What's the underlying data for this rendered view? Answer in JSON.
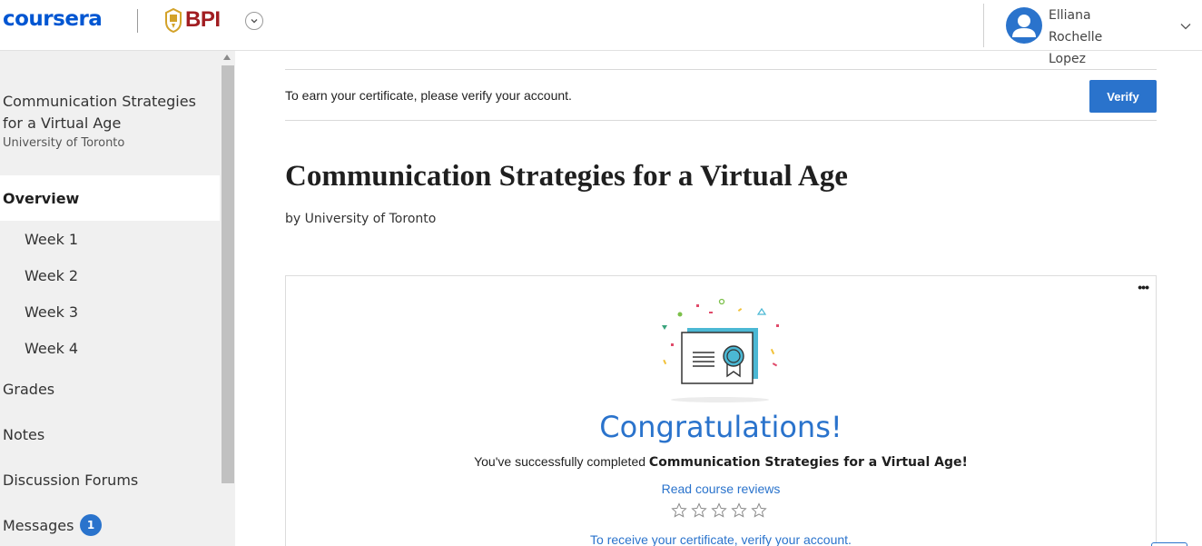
{
  "header": {
    "brand": "coursera",
    "partner": "BPI",
    "user": {
      "first_line": "Elliana Rochelle",
      "second_line": "Lopez"
    }
  },
  "sidebar": {
    "course_title": "Communication Strategies for a Virtual Age",
    "university": "University of Toronto",
    "overview": "Overview",
    "weeks": [
      "Week 1",
      "Week 2",
      "Week 3",
      "Week 4"
    ],
    "grades": "Grades",
    "notes": "Notes",
    "forums": "Discussion Forums",
    "messages": "Messages",
    "messages_badge": "1"
  },
  "main": {
    "verify_text": "To earn your certificate, please verify your account.",
    "verify_button": "Verify",
    "title": "Communication Strategies for a Virtual Age",
    "by": "by University of Toronto",
    "card": {
      "more": "•••",
      "congrats": "Congratulations!",
      "completed_prefix": "You've successfully completed ",
      "completed_course": "Communication Strategies for a Virtual Age",
      "completed_suffix": "!",
      "reviews_link": "Read course reviews",
      "receive_link": "To receive your certificate, verify your account."
    }
  },
  "colors": {
    "accent": "#2a73cc",
    "coursera_blue": "#0056d2",
    "bpi_red": "#a11d21",
    "sidebar_bg": "#f0f0f0"
  },
  "icons": {
    "switcher": "chevron-down-icon",
    "user": "user-avatar-icon",
    "user_menu": "chevron-down-icon",
    "certificate": "certificate-illustration",
    "star": "star-outline-icon"
  }
}
